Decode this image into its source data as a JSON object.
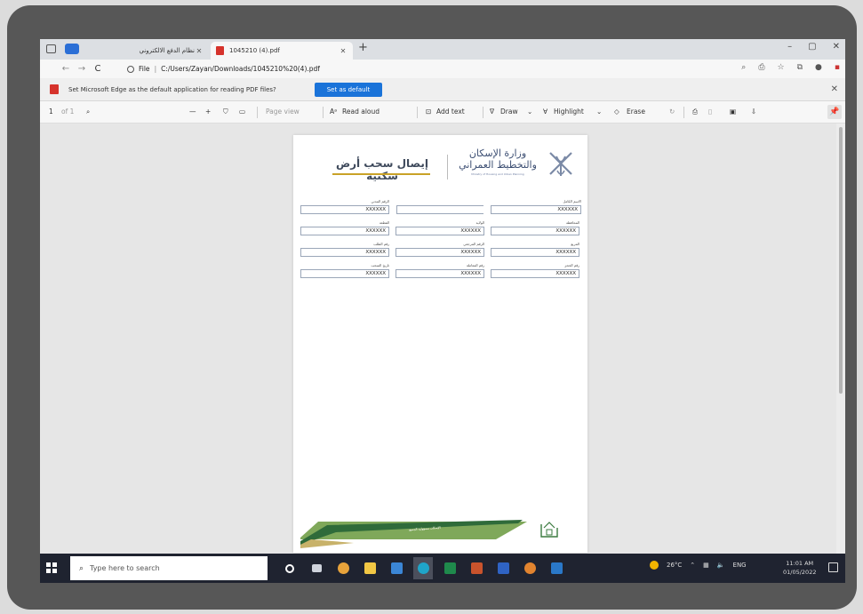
{
  "browser": {
    "tabs": [
      {
        "label": "نظام الدفع الالكتروني",
        "active": false
      },
      {
        "label": "1045210 (4).pdf",
        "active": true
      }
    ],
    "new_tab_label": "+",
    "window_controls": {
      "minimize": "–",
      "restore": "▢",
      "close": "✕"
    },
    "nav": {
      "back": "←",
      "forward": "→",
      "refresh": "C"
    },
    "address": {
      "scheme_label": "File",
      "separator": "|",
      "url": "C:/Users/Zayan/Downloads/1045210%20(4).pdf"
    }
  },
  "infobar": {
    "message": "Set Microsoft Edge as the default application for reading PDF files?",
    "button_label": "Set as default",
    "close": "✕"
  },
  "pdf_toolbar": {
    "page_number": "1",
    "page_total": "of 1",
    "zoom_out": "—",
    "zoom_in": "+",
    "page_view_label": "Page view",
    "read_aloud_label": "Read aloud",
    "add_text_label": "Add text",
    "draw_label": "Draw",
    "highlight_label": "Highlight",
    "erase_label": "Erase"
  },
  "document": {
    "title": "إيصال سحب أرض سكنية",
    "ministry_line1": "وزارة الإسكان",
    "ministry_line2": "والتخطيط العمراني",
    "ministry_en": "Ministry of Housing and Urban Planning",
    "fields": [
      {
        "label": "الاسم الكامل",
        "value": "XXXXXX"
      },
      {
        "label": "الرقم المدني",
        "value": "XXXXXX"
      },
      {
        "label": "المحافظة",
        "value": "XXXXXX"
      },
      {
        "label": "الولاية",
        "value": "XXXXXX"
      },
      {
        "label": "القطعة",
        "value": "XXXXXX"
      },
      {
        "label": "المربع",
        "value": "XXXXXX"
      },
      {
        "label": "الرقم المرجعي",
        "value": "XXXXXX"
      },
      {
        "label": "رقم الطلب",
        "value": "XXXXXX"
      },
      {
        "label": "رقم الحجز",
        "value": "XXXXXX"
      },
      {
        "label": "رقم المعاملة",
        "value": "XXXXXX"
      },
      {
        "label": "تاريخ السحب",
        "value": "XXXXXX"
      },
      {
        "label": "التوقيع",
        "value": "XXXXXX"
      }
    ],
    "footer_slogan": "الإسكان مسؤولية الجميع"
  },
  "taskbar": {
    "search_placeholder": "Type here to search",
    "temperature": "26°C",
    "language": "ENG",
    "time": "11:01 AM",
    "date": "01/05/2022"
  },
  "colors": {
    "infobar_button": "#1a73d9",
    "pdf_icon": "#d6332c",
    "doc_heading": "#3f4a5c",
    "title_underline": "#c9a227",
    "taskbar": "#1f2330"
  }
}
